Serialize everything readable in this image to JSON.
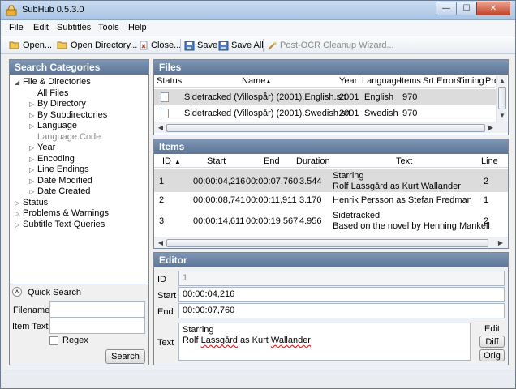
{
  "window": {
    "title": "SubHub 0.5.3.0",
    "min": "—",
    "max": "☐",
    "close": "✕"
  },
  "menu": [
    "File",
    "Edit",
    "Subtitles",
    "Tools",
    "Help"
  ],
  "toolbar": {
    "open": "Open...",
    "open_directory": "Open Directory...",
    "close": "Close...",
    "save": "Save",
    "save_all": "Save All",
    "post_ocr": "Post-OCR Cleanup Wizard..."
  },
  "categories": {
    "title": "Search Categories",
    "nodes": [
      {
        "label": "File & Directories",
        "arrow": "◢"
      },
      {
        "label": "All Files",
        "arrow": ""
      },
      {
        "label": "By Directory",
        "arrow": "▷"
      },
      {
        "label": "By Subdirectories",
        "arrow": "▷"
      },
      {
        "label": "Language",
        "arrow": "▷"
      },
      {
        "label": "Language Code",
        "arrow": ""
      },
      {
        "label": "Year",
        "arrow": "▷"
      },
      {
        "label": "Encoding",
        "arrow": "▷"
      },
      {
        "label": "Line Endings",
        "arrow": "▷"
      },
      {
        "label": "Date Modified",
        "arrow": "▷"
      },
      {
        "label": "Date Created",
        "arrow": "▷"
      },
      {
        "label": "Status",
        "arrow": "▷"
      },
      {
        "label": "Problems & Warnings",
        "arrow": "▷"
      },
      {
        "label": "Subtitle Text Queries",
        "arrow": "▷"
      }
    ]
  },
  "quick_search": {
    "title": "Quick Search",
    "toggle": "˄",
    "filename_label": "Filename",
    "filename_value": "",
    "itemtext_label": "Item Text",
    "itemtext_value": "",
    "regex_label": "Regex",
    "search_button": "Search"
  },
  "files": {
    "title": "Files",
    "columns": [
      "Status",
      "Name",
      "Year",
      "Language",
      "Items",
      "Srt Errors",
      "Timing",
      "Pro"
    ],
    "sort_indicator": "▲",
    "rows": [
      {
        "name": "Sidetracked (Villospår) (2001).English.srt",
        "year": "2001",
        "language": "English",
        "items": "970"
      },
      {
        "name": "Sidetracked (Villospår) (2001).Swedish.srt",
        "year": "2001",
        "language": "Swedish",
        "items": "970"
      }
    ]
  },
  "items": {
    "title": "Items",
    "columns": [
      "ID",
      "Start",
      "End",
      "Duration",
      "Text",
      "Line"
    ],
    "sort_indicator": "▲",
    "rows": [
      {
        "id": "1",
        "start": "00:00:04,216",
        "end": "00:00:07,760",
        "duration": "3.544",
        "text1": "Starring",
        "text2": "Rolf Lassgård as Kurt Wallander",
        "lines": "2"
      },
      {
        "id": "2",
        "start": "00:00:08,741",
        "end": "00:00:11,911",
        "duration": "3.170",
        "text1": "Henrik Persson as Stefan Fredman",
        "text2": "",
        "lines": "1"
      },
      {
        "id": "3",
        "start": "00:00:14,611",
        "end": "00:00:19,567",
        "duration": "4.956",
        "text1": "Sidetracked",
        "text2": "Based on the novel by Henning Mankell",
        "lines": "2"
      }
    ]
  },
  "editor": {
    "title": "Editor",
    "id_label": "ID",
    "id_value": "1",
    "start_label": "Start",
    "start_value": "00:00:04,216",
    "end_label": "End",
    "end_value": "00:00:07,760",
    "text_label": "Text",
    "text_line1": "Starring",
    "text_line2_a": "Rolf ",
    "text_line2_b": "Lassgård",
    "text_line2_c": " as Kurt ",
    "text_line2_d": "Wallander",
    "edit_button": "Edit",
    "diff_button": "Diff",
    "orig_button": "Orig"
  },
  "scroll": {
    "left": "◀",
    "right": "▶",
    "up": "▲",
    "down": "▼"
  },
  "colors": {
    "header": "#5c7597",
    "selected_row": "#dcdcdc",
    "accent": "#3f6aa8"
  }
}
